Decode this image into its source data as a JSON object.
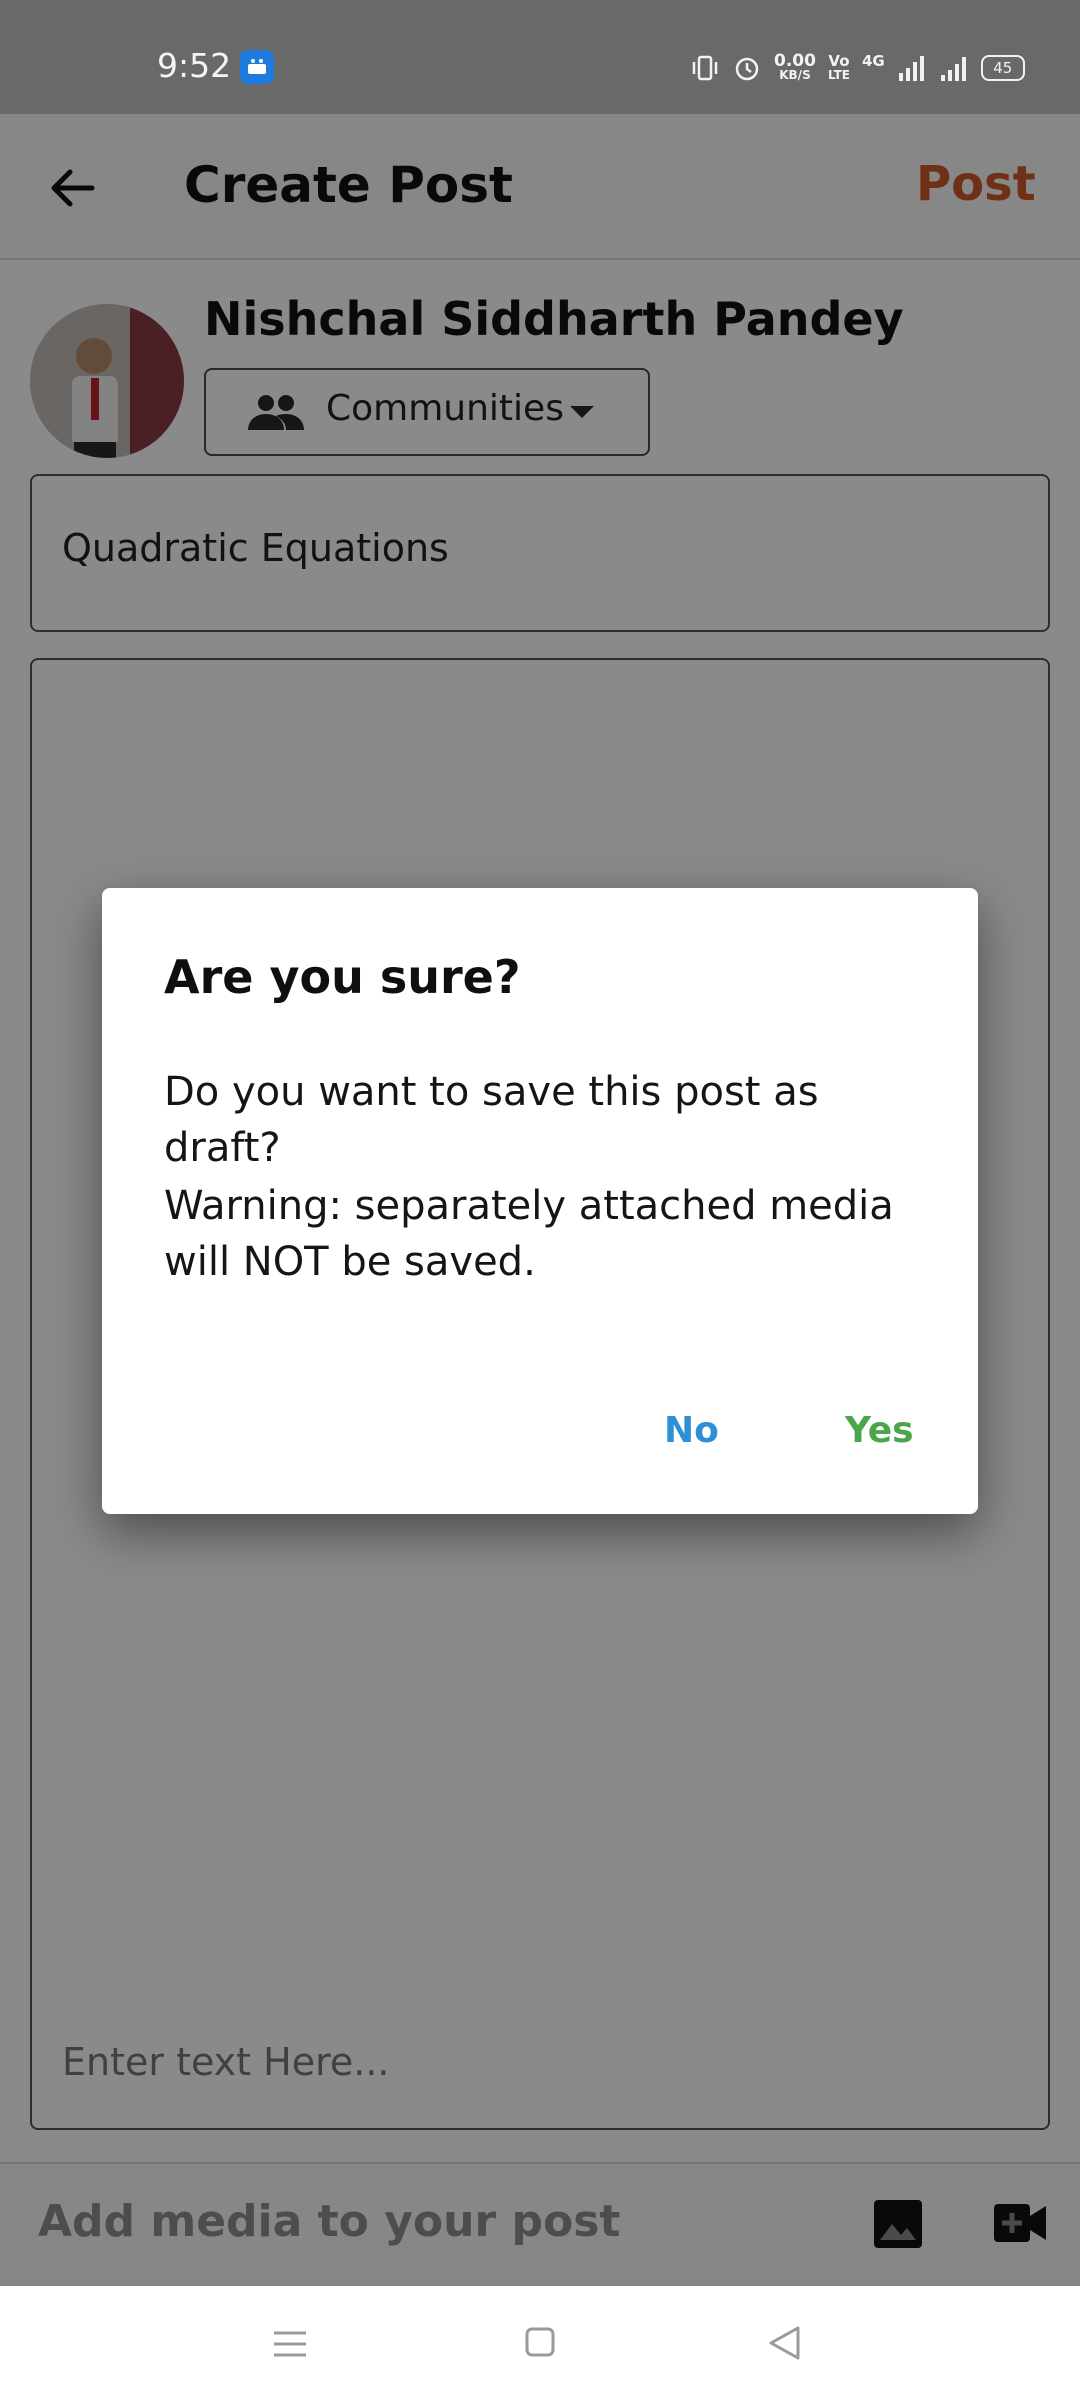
{
  "status_bar": {
    "time": "9:52",
    "speed_value": "0.00",
    "speed_unit": "KB/S",
    "volte_top": "Vo",
    "volte_bottom": "LTE",
    "network": "4G",
    "battery": "45",
    "icons": [
      "android-app-icon",
      "vibrate-icon",
      "alarm-icon",
      "signal-icon",
      "signal-icon",
      "battery-icon"
    ]
  },
  "app_bar": {
    "title": "Create Post",
    "post_label": "Post",
    "back_icon": "back-arrow-icon"
  },
  "author": {
    "name": "Nishchal Siddharth Pandey",
    "audience_label": "Communities"
  },
  "form": {
    "title_value": "Quadratic Equations",
    "body_placeholder": "Enter text Here..."
  },
  "media": {
    "label": "Add media to your post",
    "icons": [
      "image-icon",
      "video-add-icon"
    ]
  },
  "dialog": {
    "title": "Are you sure?",
    "message": "Do you want to save this post as draft?",
    "warning": "Warning: separately attached media will NOT be saved.",
    "no_label": "No",
    "yes_label": "Yes"
  },
  "colors": {
    "accent_post": "#cf5a2a",
    "no_button": "#2e8fd6",
    "yes_button": "#4aa64a"
  }
}
